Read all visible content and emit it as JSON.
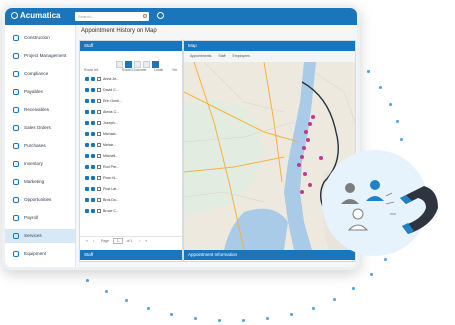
{
  "app": {
    "brand": "Acumatica",
    "search_placeholder": "Search..."
  },
  "sidebar": {
    "items": [
      {
        "label": "Construction"
      },
      {
        "label": "Project Management"
      },
      {
        "label": "Compliance"
      },
      {
        "label": "Payables"
      },
      {
        "label": "Receivables"
      },
      {
        "label": "Sales Orders"
      },
      {
        "label": "Purchases"
      },
      {
        "label": "Inventory"
      },
      {
        "label": "Marketing"
      },
      {
        "label": "Opportunities"
      },
      {
        "label": "Payroll"
      },
      {
        "label": "Services"
      },
      {
        "label": "Equipment"
      }
    ],
    "active_index": 11
  },
  "page": {
    "title": "Appointment History on Map"
  },
  "staff_panel": {
    "title": "Staff",
    "columns": [
      "Route ref.",
      "Route/Customer",
      "Locati",
      "Ver"
    ],
    "rows": [
      "Anna Je...",
      "David C...",
      "Erin Greel...",
      "Alexis C...",
      "Joseph...",
      "Michael...",
      "Meirar...",
      "Mitchell...",
      "Rod Pre...",
      "Poon N...",
      "Post Lar...",
      "Bros Du...",
      "Bruce C..."
    ],
    "pager": {
      "label": "Page",
      "current": "1",
      "of": "of 1"
    },
    "footer": "Staff"
  },
  "map_panel": {
    "title": "Map",
    "toolbar": [
      "Appointments",
      "Staff",
      "Employees"
    ],
    "footer": "Appointment Information"
  },
  "colors": {
    "accent": "#1b75bb",
    "marker": "#c0398f",
    "water": "#a9cbe8"
  }
}
